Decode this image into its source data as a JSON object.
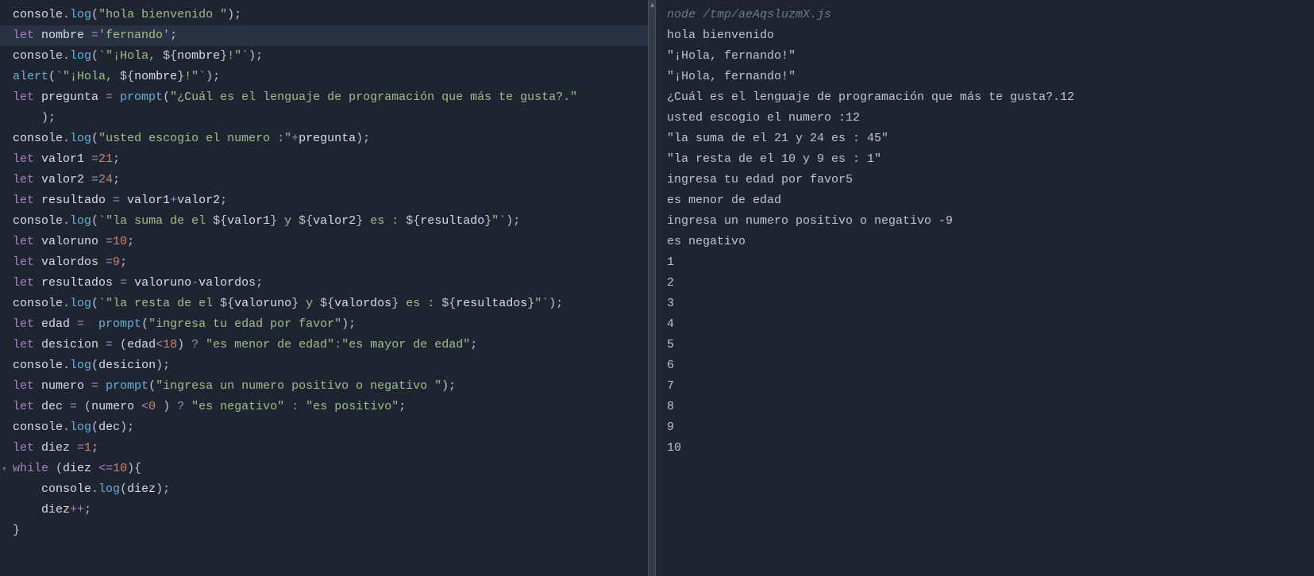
{
  "editor": {
    "lines": [
      {
        "tokens": [
          {
            "t": "console",
            "c": "obj"
          },
          {
            "t": ".",
            "c": "punct"
          },
          {
            "t": "log",
            "c": "method"
          },
          {
            "t": "(",
            "c": "punct"
          },
          {
            "t": "\"hola bienvenido \"",
            "c": "str"
          },
          {
            "t": ");",
            "c": "punct"
          }
        ]
      },
      {
        "highlight": true,
        "tokens": [
          {
            "t": "let ",
            "c": "kw"
          },
          {
            "t": "nombre ",
            "c": "var"
          },
          {
            "t": "=",
            "c": "op"
          },
          {
            "t": "'fernando'",
            "c": "str"
          },
          {
            "t": ";",
            "c": "punct"
          }
        ]
      },
      {
        "tokens": [
          {
            "t": "console",
            "c": "obj"
          },
          {
            "t": ".",
            "c": "punct"
          },
          {
            "t": "log",
            "c": "method"
          },
          {
            "t": "(",
            "c": "punct"
          },
          {
            "t": "`\"¡Hola, ",
            "c": "tmpl"
          },
          {
            "t": "${",
            "c": "punct"
          },
          {
            "t": "nombre",
            "c": "tmplvar"
          },
          {
            "t": "}",
            "c": "punct"
          },
          {
            "t": "!\"`",
            "c": "tmpl"
          },
          {
            "t": ");",
            "c": "punct"
          }
        ]
      },
      {
        "tokens": [
          {
            "t": "alert",
            "c": "method"
          },
          {
            "t": "(",
            "c": "punct"
          },
          {
            "t": "`\"¡Hola, ",
            "c": "tmpl"
          },
          {
            "t": "${",
            "c": "punct"
          },
          {
            "t": "nombre",
            "c": "tmplvar"
          },
          {
            "t": "}",
            "c": "punct"
          },
          {
            "t": "!\"`",
            "c": "tmpl"
          },
          {
            "t": ");",
            "c": "punct"
          }
        ]
      },
      {
        "tokens": [
          {
            "t": "let ",
            "c": "kw"
          },
          {
            "t": "pregunta ",
            "c": "var"
          },
          {
            "t": "= ",
            "c": "op"
          },
          {
            "t": "prompt",
            "c": "method"
          },
          {
            "t": "(",
            "c": "punct"
          },
          {
            "t": "\"¿Cuál es el lenguaje de programación que más te gusta?.\"",
            "c": "str"
          }
        ]
      },
      {
        "tokens": [
          {
            "t": "    );",
            "c": "punct"
          }
        ]
      },
      {
        "tokens": [
          {
            "t": "console",
            "c": "obj"
          },
          {
            "t": ".",
            "c": "punct"
          },
          {
            "t": "log",
            "c": "method"
          },
          {
            "t": "(",
            "c": "punct"
          },
          {
            "t": "\"usted escogio el numero :\"",
            "c": "str"
          },
          {
            "t": "+",
            "c": "op"
          },
          {
            "t": "pregunta",
            "c": "var"
          },
          {
            "t": ");",
            "c": "punct"
          }
        ]
      },
      {
        "tokens": [
          {
            "t": "let ",
            "c": "kw"
          },
          {
            "t": "valor1 ",
            "c": "var"
          },
          {
            "t": "=",
            "c": "op"
          },
          {
            "t": "21",
            "c": "num"
          },
          {
            "t": ";",
            "c": "punct"
          }
        ]
      },
      {
        "tokens": [
          {
            "t": "let ",
            "c": "kw"
          },
          {
            "t": "valor2 ",
            "c": "var"
          },
          {
            "t": "=",
            "c": "op"
          },
          {
            "t": "24",
            "c": "num"
          },
          {
            "t": ";",
            "c": "punct"
          }
        ]
      },
      {
        "tokens": [
          {
            "t": "let ",
            "c": "kw"
          },
          {
            "t": "resultado ",
            "c": "var"
          },
          {
            "t": "= ",
            "c": "op"
          },
          {
            "t": "valor1",
            "c": "var"
          },
          {
            "t": "+",
            "c": "op"
          },
          {
            "t": "valor2",
            "c": "var"
          },
          {
            "t": ";",
            "c": "punct"
          }
        ]
      },
      {
        "tokens": [
          {
            "t": "console",
            "c": "obj"
          },
          {
            "t": ".",
            "c": "punct"
          },
          {
            "t": "log",
            "c": "method"
          },
          {
            "t": "(",
            "c": "punct"
          },
          {
            "t": "`\"la suma de el ",
            "c": "tmpl"
          },
          {
            "t": "${",
            "c": "punct"
          },
          {
            "t": "valor1",
            "c": "tmplvar"
          },
          {
            "t": "}",
            "c": "punct"
          },
          {
            "t": " y ",
            "c": "tmpl"
          },
          {
            "t": "${",
            "c": "punct"
          },
          {
            "t": "valor2",
            "c": "tmplvar"
          },
          {
            "t": "}",
            "c": "punct"
          },
          {
            "t": " es : ",
            "c": "tmpl"
          },
          {
            "t": "${",
            "c": "punct"
          },
          {
            "t": "resultado",
            "c": "tmplvar"
          },
          {
            "t": "}",
            "c": "punct"
          },
          {
            "t": "\"`",
            "c": "tmpl"
          },
          {
            "t": ");",
            "c": "punct"
          }
        ]
      },
      {
        "tokens": [
          {
            "t": "let ",
            "c": "kw"
          },
          {
            "t": "valoruno ",
            "c": "var"
          },
          {
            "t": "=",
            "c": "op"
          },
          {
            "t": "10",
            "c": "num"
          },
          {
            "t": ";",
            "c": "punct"
          }
        ]
      },
      {
        "tokens": [
          {
            "t": "let ",
            "c": "kw"
          },
          {
            "t": "valordos ",
            "c": "var"
          },
          {
            "t": "=",
            "c": "op"
          },
          {
            "t": "9",
            "c": "num"
          },
          {
            "t": ";",
            "c": "punct"
          }
        ]
      },
      {
        "tokens": [
          {
            "t": "let ",
            "c": "kw"
          },
          {
            "t": "resultados ",
            "c": "var"
          },
          {
            "t": "= ",
            "c": "op"
          },
          {
            "t": "valoruno",
            "c": "var"
          },
          {
            "t": "-",
            "c": "op"
          },
          {
            "t": "valordos",
            "c": "var"
          },
          {
            "t": ";",
            "c": "punct"
          }
        ]
      },
      {
        "tokens": [
          {
            "t": "console",
            "c": "obj"
          },
          {
            "t": ".",
            "c": "punct"
          },
          {
            "t": "log",
            "c": "method"
          },
          {
            "t": "(",
            "c": "punct"
          },
          {
            "t": "`\"la resta de el ",
            "c": "tmpl"
          },
          {
            "t": "${",
            "c": "punct"
          },
          {
            "t": "valoruno",
            "c": "tmplvar"
          },
          {
            "t": "}",
            "c": "punct"
          },
          {
            "t": " y ",
            "c": "tmpl"
          },
          {
            "t": "${",
            "c": "punct"
          },
          {
            "t": "valordos",
            "c": "tmplvar"
          },
          {
            "t": "}",
            "c": "punct"
          },
          {
            "t": " es : ",
            "c": "tmpl"
          },
          {
            "t": "${",
            "c": "punct"
          },
          {
            "t": "resultados",
            "c": "tmplvar"
          },
          {
            "t": "}",
            "c": "punct"
          },
          {
            "t": "\"`",
            "c": "tmpl"
          },
          {
            "t": ");",
            "c": "punct"
          }
        ]
      },
      {
        "tokens": [
          {
            "t": "let ",
            "c": "kw"
          },
          {
            "t": "edad ",
            "c": "var"
          },
          {
            "t": "=  ",
            "c": "op"
          },
          {
            "t": "prompt",
            "c": "method"
          },
          {
            "t": "(",
            "c": "punct"
          },
          {
            "t": "\"ingresa tu edad por favor\"",
            "c": "str"
          },
          {
            "t": ");",
            "c": "punct"
          }
        ]
      },
      {
        "tokens": [
          {
            "t": "let ",
            "c": "kw"
          },
          {
            "t": "desicion ",
            "c": "var"
          },
          {
            "t": "= ",
            "c": "op"
          },
          {
            "t": "(",
            "c": "punct"
          },
          {
            "t": "edad",
            "c": "var"
          },
          {
            "t": "<",
            "c": "op"
          },
          {
            "t": "18",
            "c": "num"
          },
          {
            "t": ") ",
            "c": "punct"
          },
          {
            "t": "? ",
            "c": "op"
          },
          {
            "t": "\"es menor de edad\"",
            "c": "str"
          },
          {
            "t": ":",
            "c": "op"
          },
          {
            "t": "\"es mayor de edad\"",
            "c": "str"
          },
          {
            "t": ";",
            "c": "punct"
          }
        ]
      },
      {
        "tokens": [
          {
            "t": "console",
            "c": "obj"
          },
          {
            "t": ".",
            "c": "punct"
          },
          {
            "t": "log",
            "c": "method"
          },
          {
            "t": "(",
            "c": "punct"
          },
          {
            "t": "desicion",
            "c": "var"
          },
          {
            "t": ");",
            "c": "punct"
          }
        ]
      },
      {
        "tokens": [
          {
            "t": "let ",
            "c": "kw"
          },
          {
            "t": "numero ",
            "c": "var"
          },
          {
            "t": "= ",
            "c": "op"
          },
          {
            "t": "prompt",
            "c": "method"
          },
          {
            "t": "(",
            "c": "punct"
          },
          {
            "t": "\"ingresa un numero positivo o negativo \"",
            "c": "str"
          },
          {
            "t": ");",
            "c": "punct"
          }
        ]
      },
      {
        "tokens": [
          {
            "t": "let ",
            "c": "kw"
          },
          {
            "t": "dec ",
            "c": "var"
          },
          {
            "t": "= ",
            "c": "op"
          },
          {
            "t": "(",
            "c": "punct"
          },
          {
            "t": "numero ",
            "c": "var"
          },
          {
            "t": "<",
            "c": "op"
          },
          {
            "t": "0 ",
            "c": "num"
          },
          {
            "t": ") ",
            "c": "punct"
          },
          {
            "t": "? ",
            "c": "op"
          },
          {
            "t": "\"es negativo\"",
            "c": "str"
          },
          {
            "t": " : ",
            "c": "op"
          },
          {
            "t": "\"es positivo\"",
            "c": "str"
          },
          {
            "t": ";",
            "c": "punct"
          }
        ]
      },
      {
        "tokens": [
          {
            "t": "console",
            "c": "obj"
          },
          {
            "t": ".",
            "c": "punct"
          },
          {
            "t": "log",
            "c": "method"
          },
          {
            "t": "(",
            "c": "punct"
          },
          {
            "t": "dec",
            "c": "var"
          },
          {
            "t": ");",
            "c": "punct"
          }
        ]
      },
      {
        "tokens": [
          {
            "t": "let ",
            "c": "kw"
          },
          {
            "t": "diez ",
            "c": "var"
          },
          {
            "t": "=",
            "c": "op"
          },
          {
            "t": "1",
            "c": "num"
          },
          {
            "t": ";",
            "c": "punct"
          }
        ]
      },
      {
        "foldArrow": true,
        "tokens": [
          {
            "t": "while ",
            "c": "kw"
          },
          {
            "t": "(",
            "c": "punct"
          },
          {
            "t": "diez ",
            "c": "var"
          },
          {
            "t": "<=",
            "c": "op"
          },
          {
            "t": "10",
            "c": "num"
          },
          {
            "t": "){",
            "c": "punct"
          }
        ]
      },
      {
        "tokens": [
          {
            "t": "    console",
            "c": "obj"
          },
          {
            "t": ".",
            "c": "punct"
          },
          {
            "t": "log",
            "c": "method"
          },
          {
            "t": "(",
            "c": "punct"
          },
          {
            "t": "diez",
            "c": "var"
          },
          {
            "t": ");",
            "c": "punct"
          }
        ]
      },
      {
        "tokens": [
          {
            "t": "    diez",
            "c": "var"
          },
          {
            "t": "++",
            "c": "op"
          },
          {
            "t": ";",
            "c": "punct"
          }
        ]
      },
      {
        "tokens": [
          {
            "t": "}",
            "c": "punct"
          }
        ]
      }
    ]
  },
  "output": {
    "header": "node /tmp/aeAqsluzmX.js",
    "lines": [
      "hola bienvenido ",
      "\"¡Hola, fernando!\"",
      "\"¡Hola, fernando!\"",
      "¿Cuál es el lenguaje de programación que más te gusta?.12",
      "usted escogio el numero :12",
      "\"la suma de el 21 y 24 es : 45\"",
      "\"la resta de el 10 y 9 es : 1\"",
      "ingresa tu edad por favor5",
      "es menor de edad",
      "ingresa un numero positivo o negativo -9",
      "es negativo",
      "1",
      "2",
      "3",
      "4",
      "5",
      "6",
      "7",
      "8",
      "9",
      "10"
    ]
  }
}
